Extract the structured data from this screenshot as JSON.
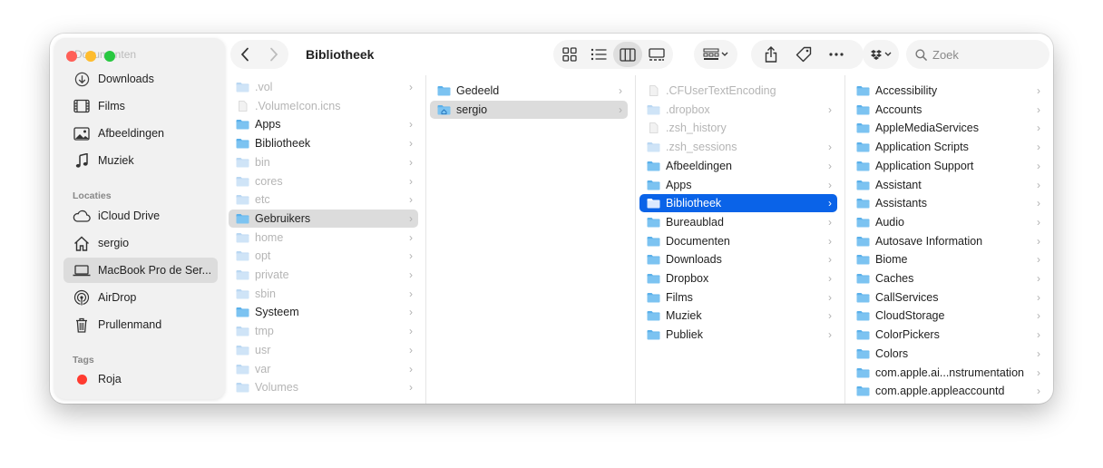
{
  "window": {
    "title": "Bibliotheek"
  },
  "sidebar": {
    "ghost_label": "Documenten",
    "favorites": [
      {
        "label": "Downloads",
        "icon": "download-icon"
      },
      {
        "label": "Films",
        "icon": "film-icon"
      },
      {
        "label": "Afbeeldingen",
        "icon": "photo-icon"
      },
      {
        "label": "Muziek",
        "icon": "music-note-icon"
      }
    ],
    "locations_heading": "Locaties",
    "locations": [
      {
        "label": "iCloud Drive",
        "icon": "cloud-icon"
      },
      {
        "label": "sergio",
        "icon": "home-icon"
      },
      {
        "label": "MacBook Pro de Ser...",
        "icon": "laptop-icon",
        "selected": true
      },
      {
        "label": "AirDrop",
        "icon": "airdrop-icon"
      },
      {
        "label": "Prullenmand",
        "icon": "trash-icon"
      }
    ],
    "tags_heading": "Tags",
    "tags": [
      {
        "label": "Roja",
        "color": "#ff3b30"
      }
    ]
  },
  "toolbar": {
    "search_placeholder": "Zoek",
    "accent": "#0a63e8"
  },
  "columns": [
    {
      "items": [
        {
          "name": ".vol",
          "dim": true,
          "chevron": true
        },
        {
          "name": ".VolumeIcon.icns",
          "dim": true,
          "file": true
        },
        {
          "name": "Apps",
          "chevron": true
        },
        {
          "name": "Bibliotheek",
          "chevron": true
        },
        {
          "name": "bin",
          "dim": true,
          "chevron": true
        },
        {
          "name": "cores",
          "dim": true,
          "chevron": true
        },
        {
          "name": "etc",
          "dim": true,
          "chevron": true
        },
        {
          "name": "Gebruikers",
          "chevron": true,
          "selected": "gray"
        },
        {
          "name": "home",
          "dim": true,
          "chevron": true
        },
        {
          "name": "opt",
          "dim": true,
          "chevron": true
        },
        {
          "name": "private",
          "dim": true,
          "chevron": true
        },
        {
          "name": "sbin",
          "dim": true,
          "chevron": true
        },
        {
          "name": "Systeem",
          "chevron": true
        },
        {
          "name": "tmp",
          "dim": true,
          "chevron": true
        },
        {
          "name": "usr",
          "dim": true,
          "chevron": true
        },
        {
          "name": "var",
          "dim": true,
          "chevron": true
        },
        {
          "name": "Volumes",
          "dim": true,
          "chevron": true
        }
      ]
    },
    {
      "items": [
        {
          "name": "Gedeeld",
          "chevron": true
        },
        {
          "name": "sergio",
          "chevron": true,
          "selected": "gray",
          "home": true
        }
      ]
    },
    {
      "items": [
        {
          "name": ".CFUserTextEncoding",
          "dim": true,
          "file": true
        },
        {
          "name": ".dropbox",
          "dim": true,
          "chevron": true
        },
        {
          "name": ".zsh_history",
          "dim": true,
          "file": true
        },
        {
          "name": ".zsh_sessions",
          "dim": true,
          "chevron": true
        },
        {
          "name": "Afbeeldingen",
          "chevron": true
        },
        {
          "name": "Apps",
          "chevron": true
        },
        {
          "name": "Bibliotheek",
          "chevron": true,
          "selected": "blue"
        },
        {
          "name": "Bureaublad",
          "chevron": true
        },
        {
          "name": "Documenten",
          "chevron": true
        },
        {
          "name": "Downloads",
          "chevron": true
        },
        {
          "name": "Dropbox",
          "chevron": true
        },
        {
          "name": "Films",
          "chevron": true
        },
        {
          "name": "Muziek",
          "chevron": true
        },
        {
          "name": "Publiek",
          "chevron": true
        }
      ]
    },
    {
      "items": [
        {
          "name": "Accessibility",
          "chevron": true
        },
        {
          "name": "Accounts",
          "chevron": true
        },
        {
          "name": "AppleMediaServices",
          "chevron": true
        },
        {
          "name": "Application Scripts",
          "chevron": true
        },
        {
          "name": "Application Support",
          "chevron": true
        },
        {
          "name": "Assistant",
          "chevron": true
        },
        {
          "name": "Assistants",
          "chevron": true
        },
        {
          "name": "Audio",
          "chevron": true
        },
        {
          "name": "Autosave Information",
          "chevron": true
        },
        {
          "name": "Biome",
          "chevron": true
        },
        {
          "name": "Caches",
          "chevron": true
        },
        {
          "name": "CallServices",
          "chevron": true
        },
        {
          "name": "CloudStorage",
          "chevron": true
        },
        {
          "name": "ColorPickers",
          "chevron": true
        },
        {
          "name": "Colors",
          "chevron": true
        },
        {
          "name": "com.apple.ai...nstrumentation",
          "chevron": true
        },
        {
          "name": "com.apple.appleaccountd",
          "chevron": true
        }
      ]
    }
  ]
}
